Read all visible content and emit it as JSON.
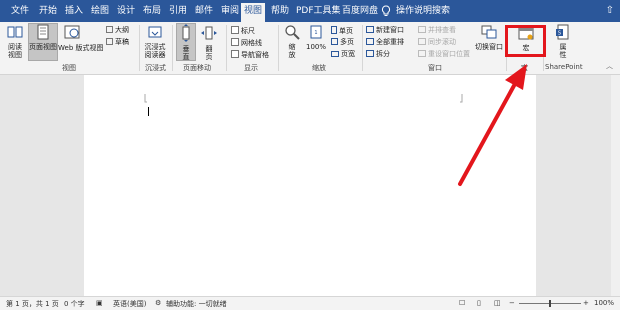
{
  "tabs": [
    {
      "label": "文件"
    },
    {
      "label": "开始"
    },
    {
      "label": "插入"
    },
    {
      "label": "绘图"
    },
    {
      "label": "设计"
    },
    {
      "label": "布局"
    },
    {
      "label": "引用"
    },
    {
      "label": "邮件"
    },
    {
      "label": "审阅"
    },
    {
      "label": "视图"
    },
    {
      "label": "帮助"
    },
    {
      "label": "PDF工具集"
    },
    {
      "label": "百度网盘"
    }
  ],
  "active_tab": "视图",
  "search": {
    "label": "操作说明搜索"
  },
  "groups": {
    "views": {
      "label": "视图",
      "read_mode": "阅读视图",
      "print_layout": "页面视图",
      "web_layout": "Web 版式视图",
      "outline": "大纲",
      "draft": "草稿"
    },
    "immersive": {
      "label": "沉浸式",
      "immersive_reader": "沉浸式阅读器"
    },
    "page_movement": {
      "label": "页面移动",
      "vertical": "垂直",
      "side_to_side": "翻页"
    },
    "show": {
      "label": "显示",
      "ruler": "标尺",
      "gridlines": "网格线",
      "nav_pane": "导航窗格"
    },
    "zoom": {
      "label": "缩放",
      "zoom": "缩放",
      "hundred": "100%",
      "one_page": "单页",
      "multiple_pages": "多页",
      "page_width": "页宽"
    },
    "window": {
      "label": "窗口",
      "new_window": "新建窗口",
      "arrange_all": "全部重排",
      "split": "拆分",
      "side_by_side": "并排查看",
      "sync_scroll": "同步滚动",
      "reset_position": "重设窗口位置",
      "switch_windows": "切换窗口"
    },
    "macros": {
      "label": "宏",
      "macros": "宏"
    },
    "sharepoint": {
      "label": "SharePoint",
      "properties": "属性"
    }
  },
  "status_bar": {
    "page": "第 1 页，共 1 页",
    "words": "0 个字",
    "language": "英语(美国)",
    "accessibility": "辅助功能: 一切就绪",
    "zoom": "100%"
  },
  "colors": {
    "brand": "#2b579a",
    "highlight": "#e3161c",
    "ribbon": "#f3f3f3"
  }
}
